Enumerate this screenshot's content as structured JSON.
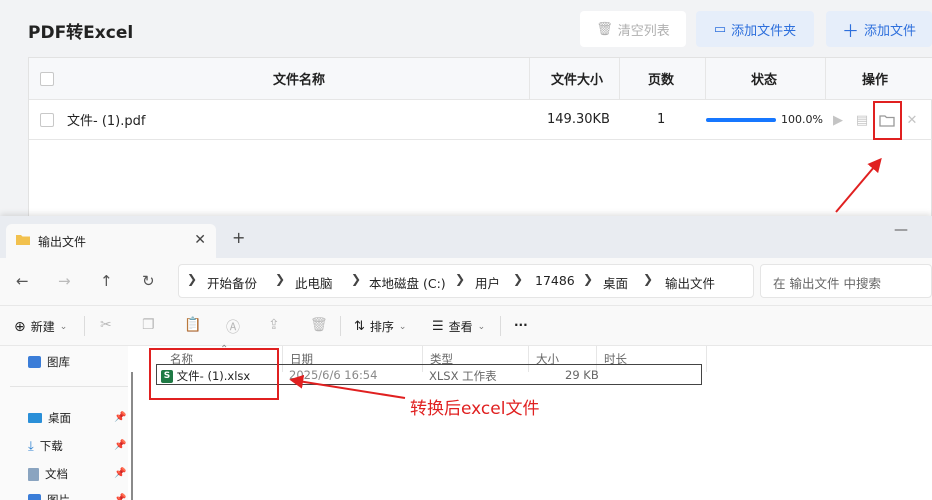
{
  "app": {
    "title": "PDF转Excel",
    "buttons": {
      "clear": "清空列表",
      "add_folder": "添加文件夹",
      "add_file": "添加文件"
    },
    "table": {
      "headers": {
        "name": "文件名称",
        "size": "文件大小",
        "pages": "页数",
        "status": "状态",
        "actions": "操作"
      },
      "rows": [
        {
          "name": "文件- (1).pdf",
          "size": "149.30KB",
          "pages": "1",
          "progress_text": "100.0%",
          "progress": 1.0
        }
      ]
    }
  },
  "explorer": {
    "tab_title": "输出文件",
    "breadcrumb": [
      "开始备份",
      "此电脑",
      "本地磁盘 (C:)",
      "用户",
      "17486",
      "桌面",
      "输出文件"
    ],
    "search_placeholder": "在 输出文件 中搜索",
    "commands": {
      "new": "新建",
      "sort": "排序",
      "view": "查看",
      "more": "···"
    },
    "nav_items": {
      "gallery": "图库",
      "desktop": "桌面",
      "downloads": "下载",
      "documents": "文档",
      "pictures": "图片"
    },
    "columns": {
      "name": "名称",
      "date": "日期",
      "type": "类型",
      "size": "大小",
      "duration": "时长"
    },
    "files": [
      {
        "name": "文件- (1).xlsx",
        "date": "2025/6/6 16:54",
        "type": "XLSX 工作表",
        "size": "29 KB"
      }
    ]
  },
  "annotation": "转换后excel文件",
  "colors": {
    "accent": "#1677ff",
    "highlight": "#e02020",
    "excel": "#1f7a45"
  }
}
